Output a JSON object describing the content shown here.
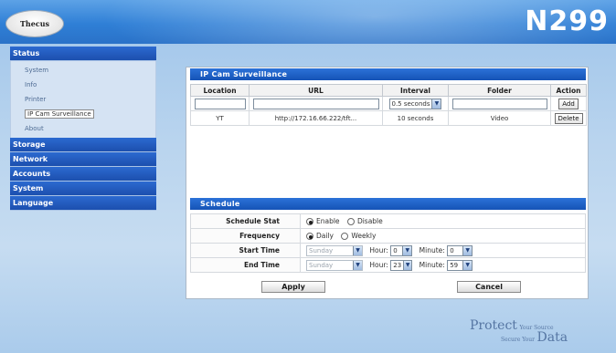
{
  "header": {
    "logo_text": "Thecus",
    "model": "N299"
  },
  "sidebar": {
    "status_label": "Status",
    "status_items": [
      "System",
      "Info",
      "Printer",
      "IP Cam Surveillance",
      "About"
    ],
    "active_item": "IP Cam Surveillance",
    "categories": [
      "Storage",
      "Network",
      "Accounts",
      "System",
      "Language"
    ]
  },
  "camera": {
    "section_title": "IP Cam Surveillance",
    "columns": [
      "Location",
      "URL",
      "Interval",
      "Folder",
      "Action"
    ],
    "new_row": {
      "location_value": "",
      "url_value": "",
      "interval_selected": "0.5 seconds",
      "folder_value": "",
      "add_label": "Add"
    },
    "rows": [
      {
        "location": "YT",
        "url": "http://172.16.66.222/tft...",
        "interval": "10 seconds",
        "folder": "Video",
        "action": "Delete"
      }
    ]
  },
  "schedule": {
    "section_title": "Schedule",
    "stat_label": "Schedule Stat",
    "stat_options": [
      "Enable",
      "Disable"
    ],
    "stat_selected": "Enable",
    "frequency_label": "Frequency",
    "frequency_options": [
      "Daily",
      "Weekly"
    ],
    "frequency_selected": "Daily",
    "start": {
      "label": "Start Time",
      "day": "Sunday",
      "hour_label": "Hour:",
      "hour": "0",
      "minute_label": "Minute:",
      "minute": "0"
    },
    "end": {
      "label": "End Time",
      "day": "Sunday",
      "hour_label": "Hour:",
      "hour": "23",
      "minute_label": "Minute:",
      "minute": "59"
    }
  },
  "buttons": {
    "apply": "Apply",
    "cancel": "Cancel"
  },
  "slogan": {
    "protect": "Protect",
    "your_source": "Your Source",
    "secure_your": "Secure Your",
    "data": "Data"
  },
  "colors": {
    "accent": "#1c4fae",
    "header": "#2f7fd6",
    "background": "#b9d4ee"
  }
}
